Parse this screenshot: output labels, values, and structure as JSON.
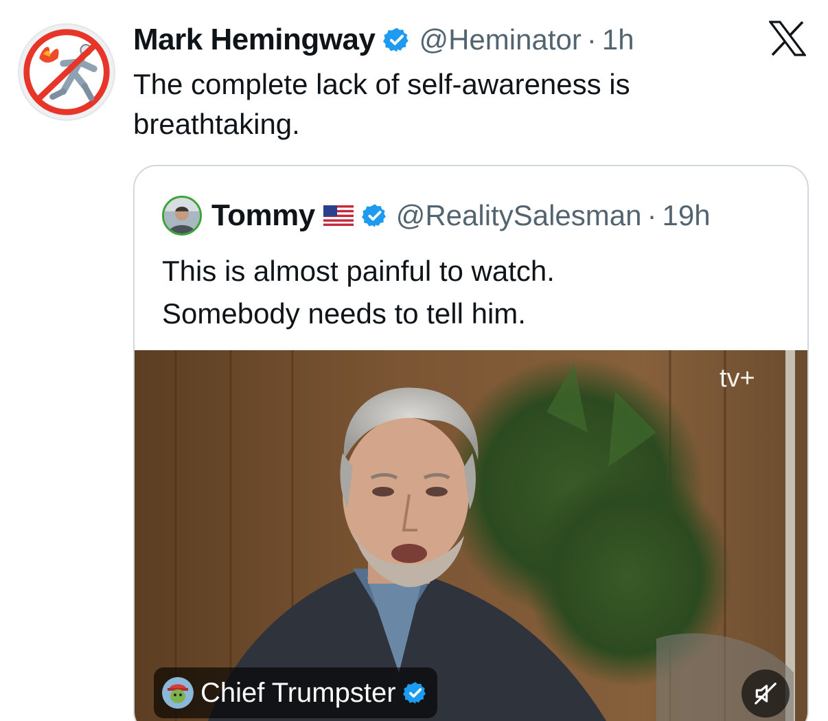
{
  "tweet": {
    "author_name": "Mark Hemingway",
    "handle": "@Heminator",
    "separator": "·",
    "time": "1h",
    "text": "The complete lack of self-awareness is breathtaking.",
    "avatar_icon": "running-man-on-fire-icon",
    "verified_icon": "verified-badge-icon"
  },
  "brand": {
    "logo_icon": "x-logo-icon"
  },
  "quoted_tweet": {
    "author_name": "Tommy",
    "flag_icon": "us-flag-icon",
    "handle": "@RealitySalesman",
    "separator": "·",
    "time": "19h",
    "text_lines": [
      "This is almost painful to watch.",
      "Somebody needs to tell him."
    ],
    "media": {
      "watermark": "tv+",
      "watermark_icon": "apple-icon",
      "creator_name": "Chief Trumpster",
      "mute_icon": "muted-speaker-icon"
    }
  },
  "colors": {
    "verified_blue": "#1d9bf0",
    "text_primary": "#0f1419",
    "text_secondary": "#536471",
    "card_border": "#cfd9de"
  }
}
